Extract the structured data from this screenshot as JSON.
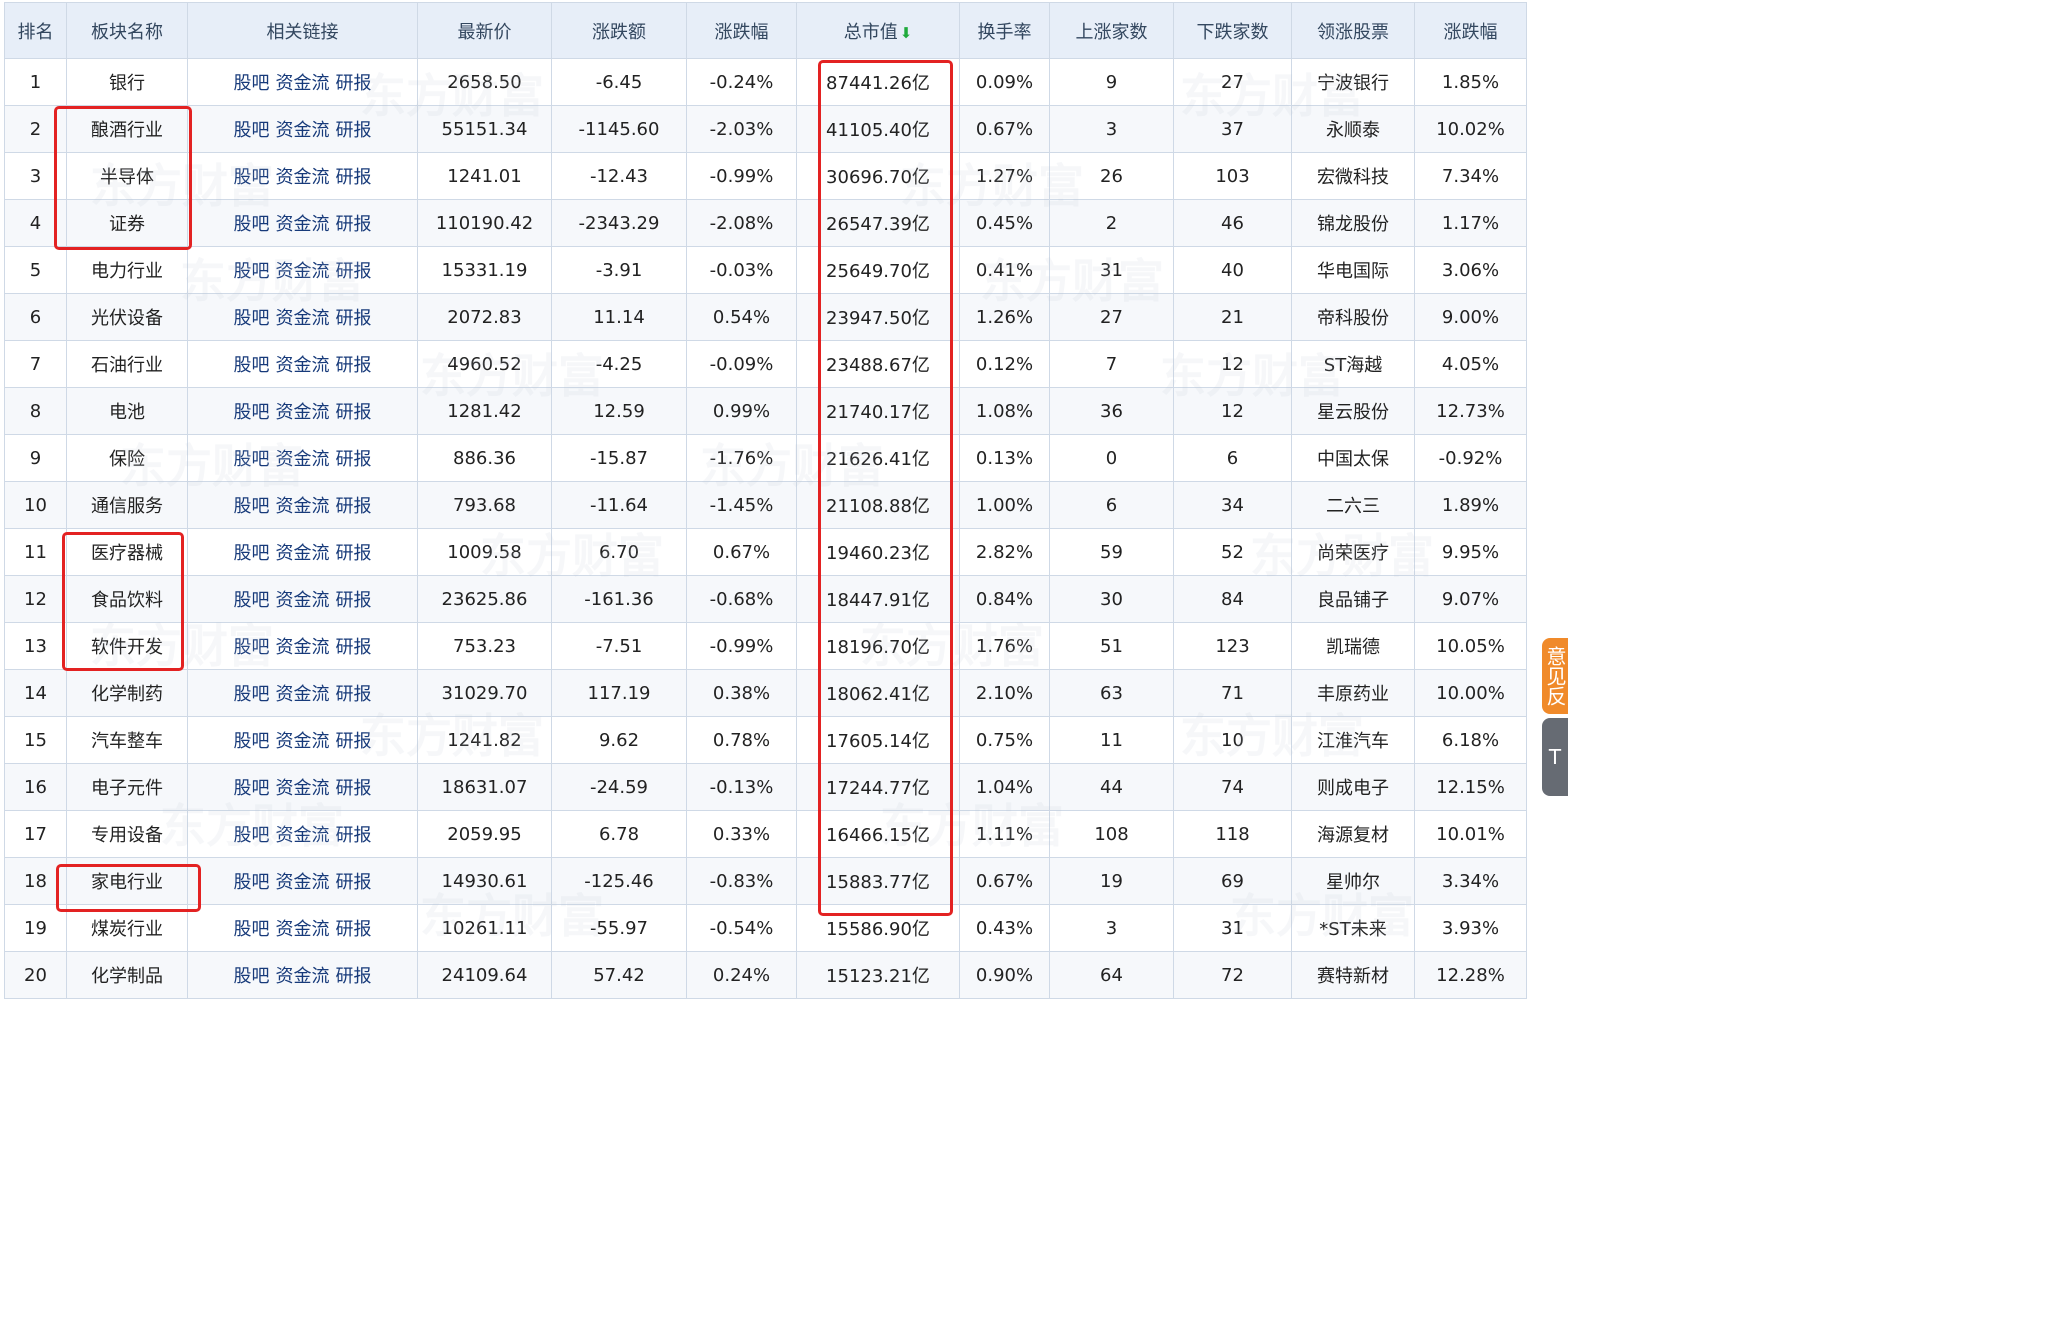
{
  "table": {
    "headers": {
      "rank": "排名",
      "name": "板块名称",
      "links": "相关链接",
      "price": "最新价",
      "change": "涨跌额",
      "pct": "涨跌幅",
      "mcap": "总市值",
      "turnover": "换手率",
      "up_count": "上涨家数",
      "down_count": "下跌家数",
      "leader": "领涨股票",
      "leader_pct": "涨跌幅"
    },
    "sort_indicator": "down-arrow-icon",
    "link_labels": [
      "股吧",
      "资金流",
      "研报"
    ],
    "rows": [
      {
        "rank": "1",
        "name": "银行",
        "price": "2658.50",
        "change": "-6.45",
        "pct": "-0.24%",
        "mcap": "87441.26亿",
        "turnover": "0.09%",
        "up": "9",
        "down": "27",
        "leader": "宁波银行",
        "leader_pct": "1.85%"
      },
      {
        "rank": "2",
        "name": "酿酒行业",
        "price": "55151.34",
        "change": "-1145.60",
        "pct": "-2.03%",
        "mcap": "41105.40亿",
        "turnover": "0.67%",
        "up": "3",
        "down": "37",
        "leader": "永顺泰",
        "leader_pct": "10.02%"
      },
      {
        "rank": "3",
        "name": "半导体",
        "price": "1241.01",
        "change": "-12.43",
        "pct": "-0.99%",
        "mcap": "30696.70亿",
        "turnover": "1.27%",
        "up": "26",
        "down": "103",
        "leader": "宏微科技",
        "leader_pct": "7.34%"
      },
      {
        "rank": "4",
        "name": "证券",
        "price": "110190.42",
        "change": "-2343.29",
        "pct": "-2.08%",
        "mcap": "26547.39亿",
        "turnover": "0.45%",
        "up": "2",
        "down": "46",
        "leader": "锦龙股份",
        "leader_pct": "1.17%"
      },
      {
        "rank": "5",
        "name": "电力行业",
        "price": "15331.19",
        "change": "-3.91",
        "pct": "-0.03%",
        "mcap": "25649.70亿",
        "turnover": "0.41%",
        "up": "31",
        "down": "40",
        "leader": "华电国际",
        "leader_pct": "3.06%"
      },
      {
        "rank": "6",
        "name": "光伏设备",
        "price": "2072.83",
        "change": "11.14",
        "pct": "0.54%",
        "mcap": "23947.50亿",
        "turnover": "1.26%",
        "up": "27",
        "down": "21",
        "leader": "帝科股份",
        "leader_pct": "9.00%"
      },
      {
        "rank": "7",
        "name": "石油行业",
        "price": "4960.52",
        "change": "-4.25",
        "pct": "-0.09%",
        "mcap": "23488.67亿",
        "turnover": "0.12%",
        "up": "7",
        "down": "12",
        "leader": "ST海越",
        "leader_pct": "4.05%"
      },
      {
        "rank": "8",
        "name": "电池",
        "price": "1281.42",
        "change": "12.59",
        "pct": "0.99%",
        "mcap": "21740.17亿",
        "turnover": "1.08%",
        "up": "36",
        "down": "12",
        "leader": "星云股份",
        "leader_pct": "12.73%"
      },
      {
        "rank": "9",
        "name": "保险",
        "price": "886.36",
        "change": "-15.87",
        "pct": "-1.76%",
        "mcap": "21626.41亿",
        "turnover": "0.13%",
        "up": "0",
        "down": "6",
        "leader": "中国太保",
        "leader_pct": "-0.92%"
      },
      {
        "rank": "10",
        "name": "通信服务",
        "price": "793.68",
        "change": "-11.64",
        "pct": "-1.45%",
        "mcap": "21108.88亿",
        "turnover": "1.00%",
        "up": "6",
        "down": "34",
        "leader": "二六三",
        "leader_pct": "1.89%"
      },
      {
        "rank": "11",
        "name": "医疗器械",
        "price": "1009.58",
        "change": "6.70",
        "pct": "0.67%",
        "mcap": "19460.23亿",
        "turnover": "2.82%",
        "up": "59",
        "down": "52",
        "leader": "尚荣医疗",
        "leader_pct": "9.95%"
      },
      {
        "rank": "12",
        "name": "食品饮料",
        "price": "23625.86",
        "change": "-161.36",
        "pct": "-0.68%",
        "mcap": "18447.91亿",
        "turnover": "0.84%",
        "up": "30",
        "down": "84",
        "leader": "良品铺子",
        "leader_pct": "9.07%"
      },
      {
        "rank": "13",
        "name": "软件开发",
        "price": "753.23",
        "change": "-7.51",
        "pct": "-0.99%",
        "mcap": "18196.70亿",
        "turnover": "1.76%",
        "up": "51",
        "down": "123",
        "leader": "凯瑞德",
        "leader_pct": "10.05%"
      },
      {
        "rank": "14",
        "name": "化学制药",
        "price": "31029.70",
        "change": "117.19",
        "pct": "0.38%",
        "mcap": "18062.41亿",
        "turnover": "2.10%",
        "up": "63",
        "down": "71",
        "leader": "丰原药业",
        "leader_pct": "10.00%"
      },
      {
        "rank": "15",
        "name": "汽车整车",
        "price": "1241.82",
        "change": "9.62",
        "pct": "0.78%",
        "mcap": "17605.14亿",
        "turnover": "0.75%",
        "up": "11",
        "down": "10",
        "leader": "江淮汽车",
        "leader_pct": "6.18%"
      },
      {
        "rank": "16",
        "name": "电子元件",
        "price": "18631.07",
        "change": "-24.59",
        "pct": "-0.13%",
        "mcap": "17244.77亿",
        "turnover": "1.04%",
        "up": "44",
        "down": "74",
        "leader": "则成电子",
        "leader_pct": "12.15%"
      },
      {
        "rank": "17",
        "name": "专用设备",
        "price": "2059.95",
        "change": "6.78",
        "pct": "0.33%",
        "mcap": "16466.15亿",
        "turnover": "1.11%",
        "up": "108",
        "down": "118",
        "leader": "海源复材",
        "leader_pct": "10.01%"
      },
      {
        "rank": "18",
        "name": "家电行业",
        "price": "14930.61",
        "change": "-125.46",
        "pct": "-0.83%",
        "mcap": "15883.77亿",
        "turnover": "0.67%",
        "up": "19",
        "down": "69",
        "leader": "星帅尔",
        "leader_pct": "3.34%"
      },
      {
        "rank": "19",
        "name": "煤炭行业",
        "price": "10261.11",
        "change": "-55.97",
        "pct": "-0.54%",
        "mcap": "15586.90亿",
        "turnover": "0.43%",
        "up": "3",
        "down": "31",
        "leader": "*ST未来",
        "leader_pct": "3.93%"
      },
      {
        "rank": "20",
        "name": "化学制品",
        "price": "24109.64",
        "change": "57.42",
        "pct": "0.24%",
        "mcap": "15123.21亿",
        "turnover": "0.90%",
        "up": "64",
        "down": "72",
        "leader": "赛特新材",
        "leader_pct": "12.28%"
      }
    ]
  },
  "watermark": "东方财富",
  "colors": {
    "up": "#e51c23",
    "down": "#0a9b2b",
    "link": "#173a7a",
    "annotation": "#e32222"
  },
  "side_tabs": {
    "orange_text": "意见反",
    "gray_text": "T"
  }
}
